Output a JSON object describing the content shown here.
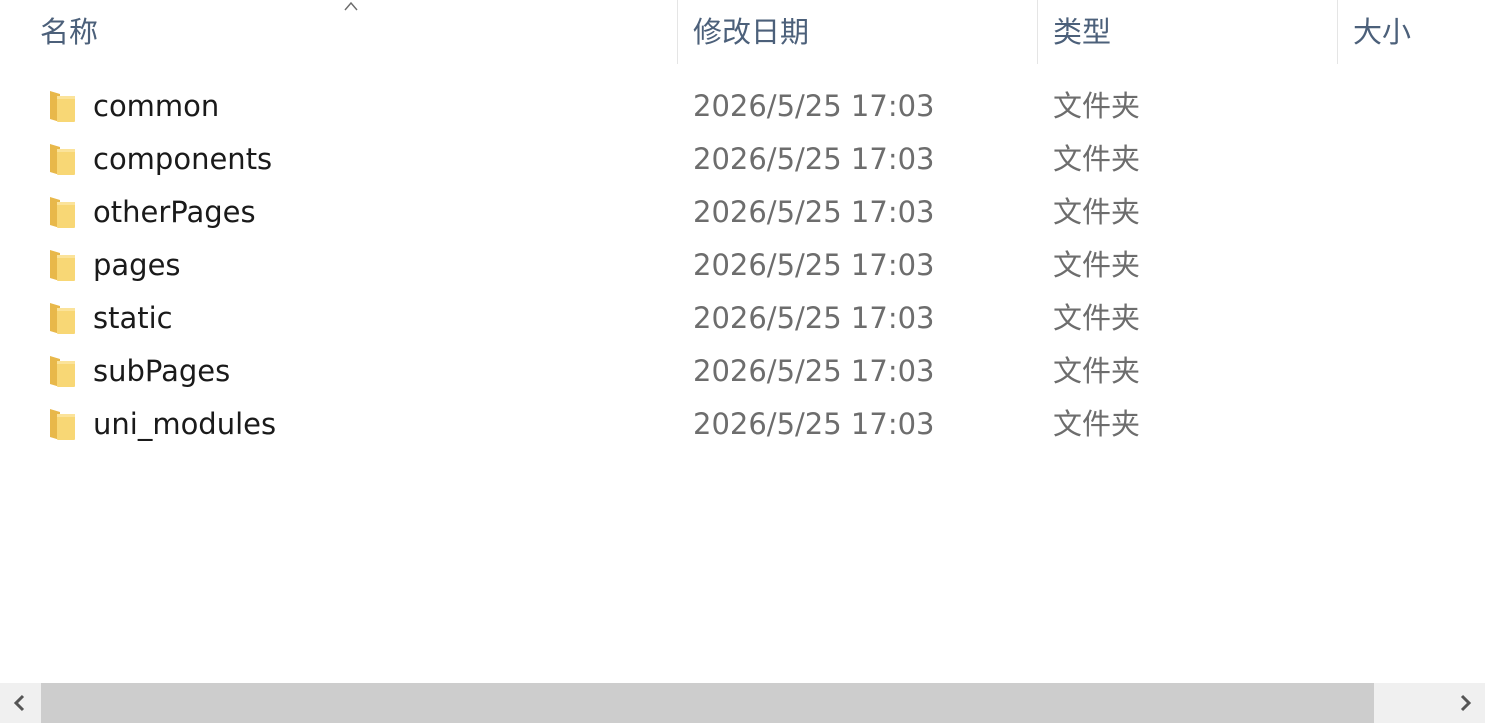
{
  "columns": {
    "name": "名称",
    "modified": "修改日期",
    "type": "类型",
    "size": "大小"
  },
  "sort": {
    "column": "name",
    "direction": "ascending",
    "icon": "sort-up-caret-icon"
  },
  "files": [
    {
      "name": "common",
      "modified": "2026/5/25 17:03",
      "type": "文件夹",
      "size": "",
      "icon": "folder-icon"
    },
    {
      "name": "components",
      "modified": "2026/5/25 17:03",
      "type": "文件夹",
      "size": "",
      "icon": "folder-icon"
    },
    {
      "name": "otherPages",
      "modified": "2026/5/25 17:03",
      "type": "文件夹",
      "size": "",
      "icon": "folder-icon"
    },
    {
      "name": "pages",
      "modified": "2026/5/25 17:03",
      "type": "文件夹",
      "size": "",
      "icon": "folder-icon"
    },
    {
      "name": "static",
      "modified": "2026/5/25 17:03",
      "type": "文件夹",
      "size": "",
      "icon": "folder-icon"
    },
    {
      "name": "subPages",
      "modified": "2026/5/25 17:03",
      "type": "文件夹",
      "size": "",
      "icon": "folder-icon"
    },
    {
      "name": "uni_modules",
      "modified": "2026/5/25 17:03",
      "type": "文件夹",
      "size": "",
      "icon": "folder-icon"
    }
  ],
  "scrollbar": {
    "left_icon": "chevron-left-icon",
    "right_icon": "chevron-right-icon"
  },
  "colors": {
    "header_text": "#4c607a",
    "name_text": "#1a1a1a",
    "meta_text": "#6d6d6d",
    "folder": "#f8d775",
    "scroll_track": "#f0f0f0",
    "scroll_thumb": "#cdcdcd"
  }
}
